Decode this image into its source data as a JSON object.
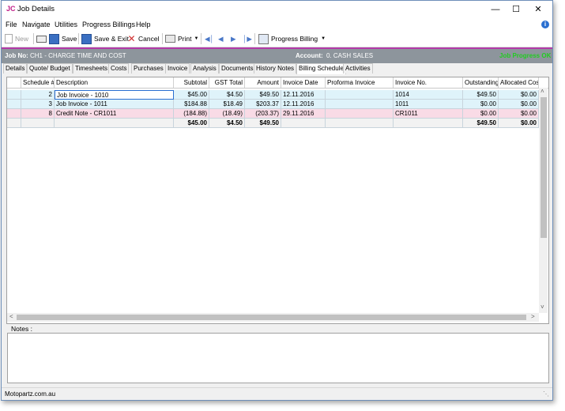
{
  "window": {
    "app_logo": "JC",
    "title": "Job Details"
  },
  "menu": {
    "items": [
      "File",
      "Navigate",
      "Utilities",
      "Progress Billings",
      "Help"
    ]
  },
  "toolbar": {
    "new_label": "New",
    "save_label": "Save",
    "save_exit_label": "Save & Exit",
    "cancel_label": "Cancel",
    "print_label": "Print",
    "progress_billing_label": "Progress Billing"
  },
  "job": {
    "job_no_label": "Job No:",
    "job_no_value": "CH1 - CHARGE TIME AND COST",
    "account_label": "Account:",
    "account_value": "0. CASH SALES",
    "progress_status": "Job Progress OK"
  },
  "tabs": [
    "Details",
    "Quote/ Budget",
    "Timesheets",
    "Costs",
    "Purchases",
    "Invoice",
    "Analysis",
    "Documents",
    "History Notes",
    "Billing Schedule",
    "Activities"
  ],
  "active_tab": "Billing Schedule",
  "grid": {
    "columns": [
      "Schedule #",
      "Description",
      "Subtotal",
      "GST Total",
      "Amount",
      "Invoice Date",
      "Proforma Invoice",
      "Invoice No.",
      "Outstanding",
      "Allocated Costs"
    ],
    "rows": [
      {
        "schedule": "2",
        "description": "Job Invoice - 1010",
        "subtotal": "$45.00",
        "gst": "$4.50",
        "amount": "$49.50",
        "invoice_date": "12.11.2016",
        "proforma": "",
        "invoice_no": "1014",
        "outstanding": "$49.50",
        "allocated": "$0.00"
      },
      {
        "schedule": "3",
        "description": "Job Invoice - 1011",
        "subtotal": "$184.88",
        "gst": "$18.49",
        "amount": "$203.37",
        "invoice_date": "12.11.2016",
        "proforma": "",
        "invoice_no": "1011",
        "outstanding": "$0.00",
        "allocated": "$0.00"
      },
      {
        "schedule": "8",
        "description": "Credit Note - CR1011",
        "subtotal": "(184.88)",
        "gst": "(18.49)",
        "amount": "(203.37)",
        "invoice_date": "29.11.2016",
        "proforma": "",
        "invoice_no": "CR1011",
        "outstanding": "$0.00",
        "allocated": "$0.00"
      }
    ],
    "totals": {
      "subtotal": "$45.00",
      "gst": "$4.50",
      "amount": "$49.50",
      "outstanding": "$49.50",
      "allocated": "$0.00"
    }
  },
  "notes": {
    "label": "Notes :"
  },
  "status": {
    "company": "Motopartz.com.au"
  },
  "colors": {
    "row_blue": "#dff3fa",
    "row_pink": "#f9dbe6",
    "progress_ok": "#22cc22",
    "selection": "#3399ff"
  }
}
